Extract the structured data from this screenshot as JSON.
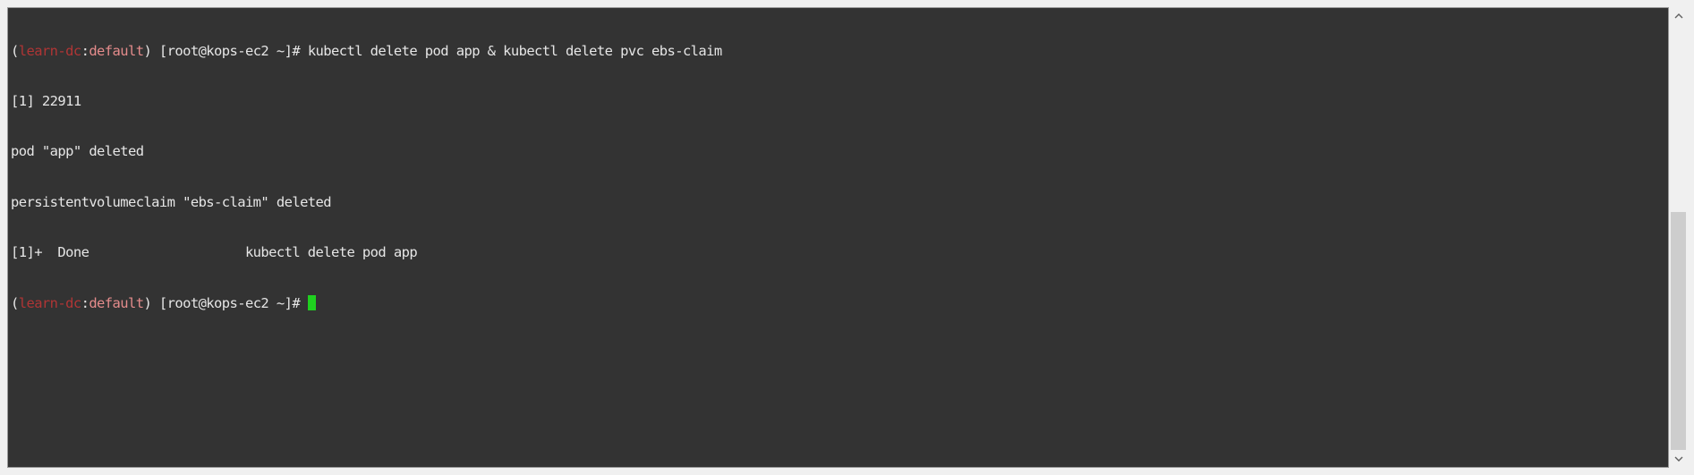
{
  "terminal": {
    "lines": [
      {
        "paren_open": "(",
        "context": "learn-dc",
        "colon": ":",
        "namespace": "default",
        "prompt_rest": ") [root@kops-ec2 ~]# ",
        "command": "kubectl delete pod app & kubectl delete pvc ebs-claim"
      },
      {
        "text": "[1] 22911"
      },
      {
        "text": "pod \"app\" deleted"
      },
      {
        "text": "persistentvolumeclaim \"ebs-claim\" deleted"
      },
      {
        "text": "[1]+  Done                    kubectl delete pod app"
      },
      {
        "paren_open": "(",
        "context": "learn-dc",
        "colon": ":",
        "namespace": "default",
        "prompt_rest": ") [root@kops-ec2 ~]# ",
        "command": ""
      }
    ],
    "colors": {
      "background": "#333333",
      "text": "#e6e6e6",
      "context": "#b03535",
      "namespace": "#e58c8c",
      "cursor": "#1fd01f"
    }
  },
  "scrollbar": {
    "up_icon": "chevron-up-icon",
    "down_icon": "chevron-down-icon",
    "position_fraction": 1.0,
    "visible_fraction": 0.56
  }
}
